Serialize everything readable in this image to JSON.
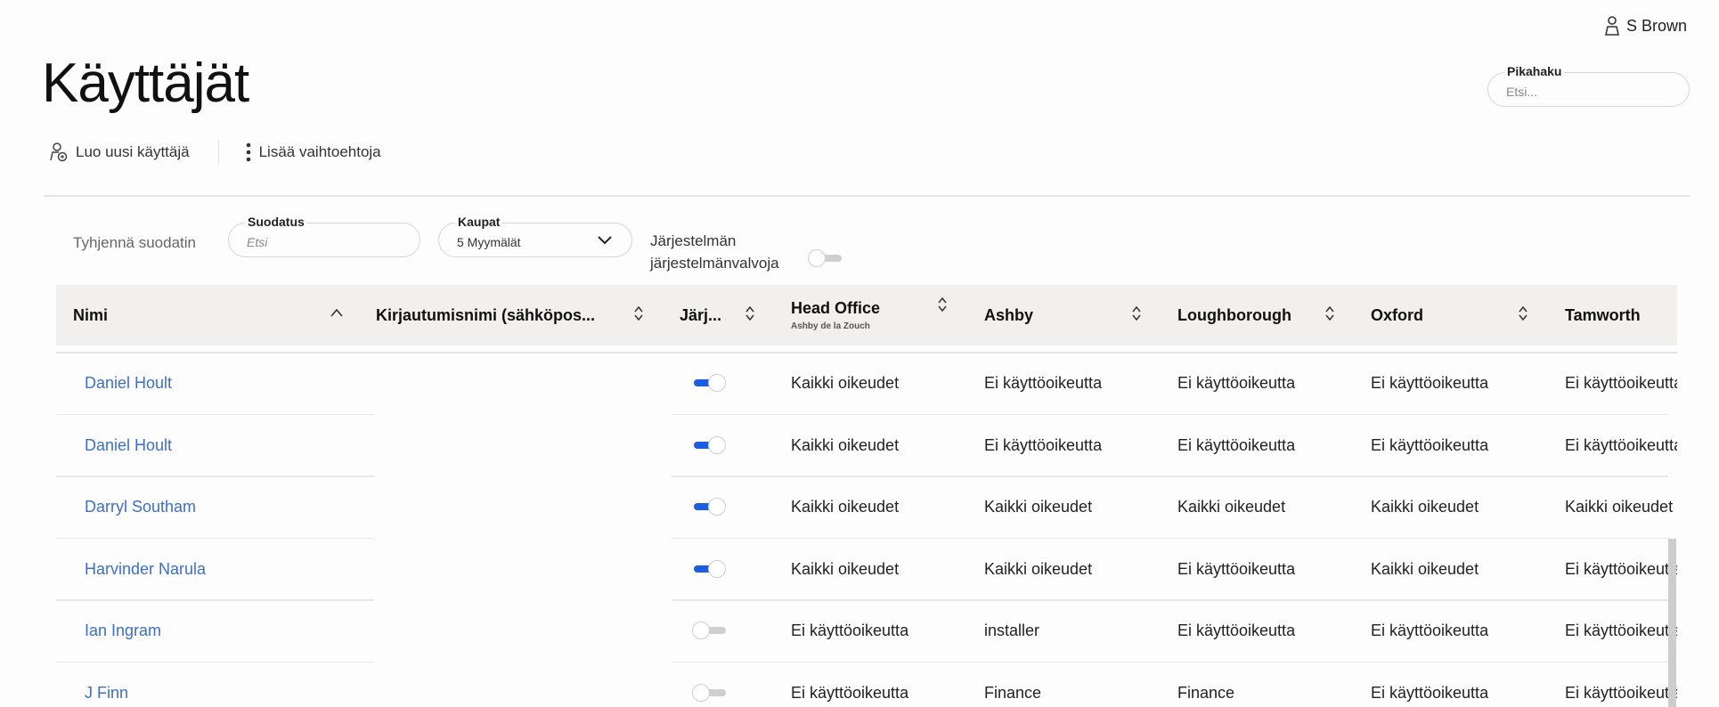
{
  "user": {
    "name": "S Brown",
    "icon": "user-icon"
  },
  "page_title": "Käyttäjät",
  "quick_search": {
    "label": "Pikahaku",
    "placeholder": "Etsi..."
  },
  "actions": {
    "create_user": "Luo uusi käyttäjä",
    "more_options": "Lisää vaihtoehtoja"
  },
  "filters": {
    "clear": "Tyhjennä suodatin",
    "filter": {
      "label": "Suodatus",
      "placeholder": "Etsi"
    },
    "stores": {
      "label": "Kaupat",
      "value": "5 Myymälät"
    },
    "sysadmin": {
      "label_line1": "Järjestelmän",
      "label_line2": "järjestelmänvalvoja",
      "on": false
    }
  },
  "colors": {
    "link": "#3d6fc6",
    "toggle_on": "#1b5fe0",
    "header_bg": "#f1f0ee"
  },
  "table": {
    "columns": [
      {
        "label": "Nimi",
        "sort": "asc"
      },
      {
        "label": "Kirjautumisnimi (sähköpos...",
        "sort": "none"
      },
      {
        "label": "Järj...",
        "sort": "none"
      },
      {
        "label": "Head Office",
        "sub": "Ashby de la Zouch",
        "sort": "none"
      },
      {
        "label": "Ashby",
        "sort": "none"
      },
      {
        "label": "Loughborough",
        "sort": "none"
      },
      {
        "label": "Oxford",
        "sort": "none"
      },
      {
        "label": "Tamworth",
        "sort": "none"
      }
    ],
    "rows": [
      {
        "name": "Daniel Hoult",
        "login": "",
        "sysadmin": true,
        "stores": [
          "Kaikki oikeudet",
          "Ei käyttöoikeutta",
          "Ei käyttöoikeutta",
          "Ei käyttöoikeutta",
          "Ei käyttöoikeutta"
        ]
      },
      {
        "name": "Daniel Hoult",
        "login": "",
        "sysadmin": true,
        "stores": [
          "Kaikki oikeudet",
          "Ei käyttöoikeutta",
          "Ei käyttöoikeutta",
          "Ei käyttöoikeutta",
          "Ei käyttöoikeutta"
        ]
      },
      {
        "name": "Darryl Southam",
        "login": "",
        "sysadmin": true,
        "stores": [
          "Kaikki oikeudet",
          "Kaikki oikeudet",
          "Kaikki oikeudet",
          "Kaikki oikeudet",
          "Kaikki oikeudet"
        ]
      },
      {
        "name": "Harvinder Narula",
        "login": "",
        "sysadmin": true,
        "stores": [
          "Kaikki oikeudet",
          "Kaikki oikeudet",
          "Ei käyttöoikeutta",
          "Kaikki oikeudet",
          "Ei käyttöoikeutta"
        ]
      },
      {
        "name": "Ian Ingram",
        "login": "",
        "sysadmin": false,
        "stores": [
          "Ei käyttöoikeutta",
          "installer",
          "Ei käyttöoikeutta",
          "Ei käyttöoikeutta",
          "Ei käyttöoikeutta"
        ]
      },
      {
        "name": "J Finn",
        "login": "",
        "sysadmin": false,
        "stores": [
          "Ei käyttöoikeutta",
          "Finance",
          "Finance",
          "Ei käyttöoikeutta",
          "Ei käyttöoikeutta"
        ]
      }
    ]
  }
}
